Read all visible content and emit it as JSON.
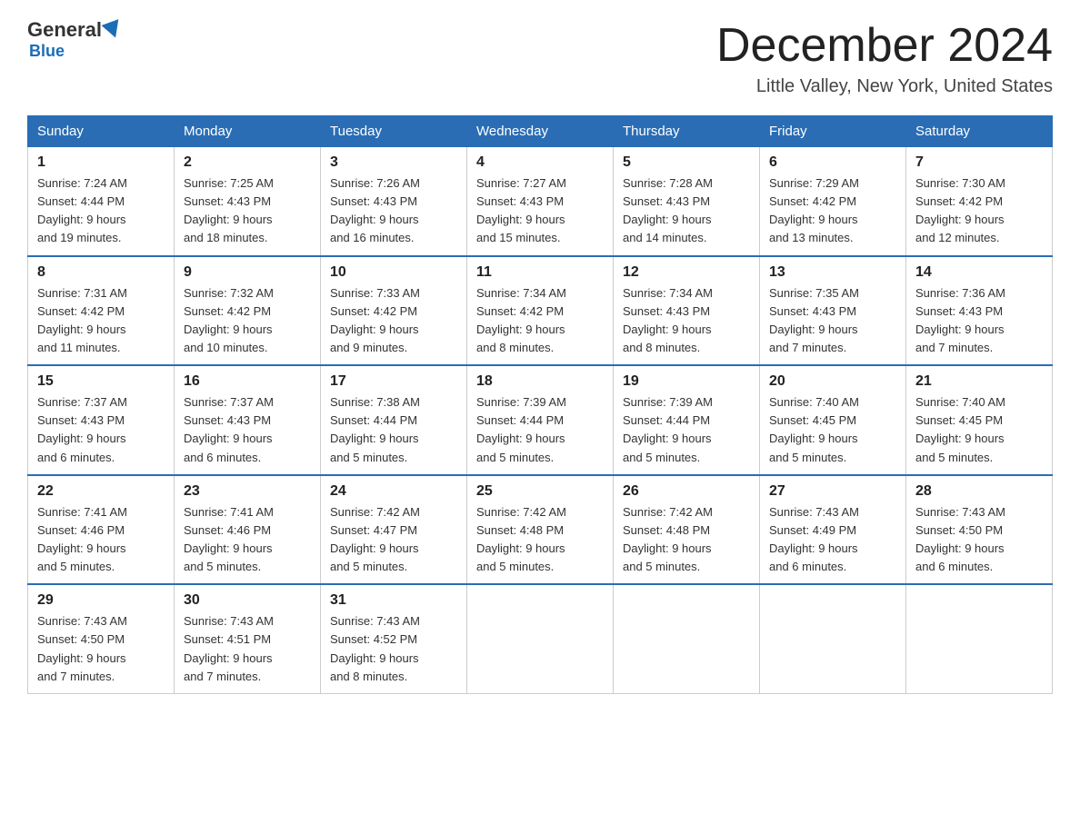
{
  "header": {
    "logo_general": "General",
    "logo_blue": "Blue",
    "month_title": "December 2024",
    "location": "Little Valley, New York, United States"
  },
  "weekdays": [
    "Sunday",
    "Monday",
    "Tuesday",
    "Wednesday",
    "Thursday",
    "Friday",
    "Saturday"
  ],
  "weeks": [
    [
      {
        "day": "1",
        "sunrise": "7:24 AM",
        "sunset": "4:44 PM",
        "daylight": "9 hours and 19 minutes."
      },
      {
        "day": "2",
        "sunrise": "7:25 AM",
        "sunset": "4:43 PM",
        "daylight": "9 hours and 18 minutes."
      },
      {
        "day": "3",
        "sunrise": "7:26 AM",
        "sunset": "4:43 PM",
        "daylight": "9 hours and 16 minutes."
      },
      {
        "day": "4",
        "sunrise": "7:27 AM",
        "sunset": "4:43 PM",
        "daylight": "9 hours and 15 minutes."
      },
      {
        "day": "5",
        "sunrise": "7:28 AM",
        "sunset": "4:43 PM",
        "daylight": "9 hours and 14 minutes."
      },
      {
        "day": "6",
        "sunrise": "7:29 AM",
        "sunset": "4:42 PM",
        "daylight": "9 hours and 13 minutes."
      },
      {
        "day": "7",
        "sunrise": "7:30 AM",
        "sunset": "4:42 PM",
        "daylight": "9 hours and 12 minutes."
      }
    ],
    [
      {
        "day": "8",
        "sunrise": "7:31 AM",
        "sunset": "4:42 PM",
        "daylight": "9 hours and 11 minutes."
      },
      {
        "day": "9",
        "sunrise": "7:32 AM",
        "sunset": "4:42 PM",
        "daylight": "9 hours and 10 minutes."
      },
      {
        "day": "10",
        "sunrise": "7:33 AM",
        "sunset": "4:42 PM",
        "daylight": "9 hours and 9 minutes."
      },
      {
        "day": "11",
        "sunrise": "7:34 AM",
        "sunset": "4:42 PM",
        "daylight": "9 hours and 8 minutes."
      },
      {
        "day": "12",
        "sunrise": "7:34 AM",
        "sunset": "4:43 PM",
        "daylight": "9 hours and 8 minutes."
      },
      {
        "day": "13",
        "sunrise": "7:35 AM",
        "sunset": "4:43 PM",
        "daylight": "9 hours and 7 minutes."
      },
      {
        "day": "14",
        "sunrise": "7:36 AM",
        "sunset": "4:43 PM",
        "daylight": "9 hours and 7 minutes."
      }
    ],
    [
      {
        "day": "15",
        "sunrise": "7:37 AM",
        "sunset": "4:43 PM",
        "daylight": "9 hours and 6 minutes."
      },
      {
        "day": "16",
        "sunrise": "7:37 AM",
        "sunset": "4:43 PM",
        "daylight": "9 hours and 6 minutes."
      },
      {
        "day": "17",
        "sunrise": "7:38 AM",
        "sunset": "4:44 PM",
        "daylight": "9 hours and 5 minutes."
      },
      {
        "day": "18",
        "sunrise": "7:39 AM",
        "sunset": "4:44 PM",
        "daylight": "9 hours and 5 minutes."
      },
      {
        "day": "19",
        "sunrise": "7:39 AM",
        "sunset": "4:44 PM",
        "daylight": "9 hours and 5 minutes."
      },
      {
        "day": "20",
        "sunrise": "7:40 AM",
        "sunset": "4:45 PM",
        "daylight": "9 hours and 5 minutes."
      },
      {
        "day": "21",
        "sunrise": "7:40 AM",
        "sunset": "4:45 PM",
        "daylight": "9 hours and 5 minutes."
      }
    ],
    [
      {
        "day": "22",
        "sunrise": "7:41 AM",
        "sunset": "4:46 PM",
        "daylight": "9 hours and 5 minutes."
      },
      {
        "day": "23",
        "sunrise": "7:41 AM",
        "sunset": "4:46 PM",
        "daylight": "9 hours and 5 minutes."
      },
      {
        "day": "24",
        "sunrise": "7:42 AM",
        "sunset": "4:47 PM",
        "daylight": "9 hours and 5 minutes."
      },
      {
        "day": "25",
        "sunrise": "7:42 AM",
        "sunset": "4:48 PM",
        "daylight": "9 hours and 5 minutes."
      },
      {
        "day": "26",
        "sunrise": "7:42 AM",
        "sunset": "4:48 PM",
        "daylight": "9 hours and 5 minutes."
      },
      {
        "day": "27",
        "sunrise": "7:43 AM",
        "sunset": "4:49 PM",
        "daylight": "9 hours and 6 minutes."
      },
      {
        "day": "28",
        "sunrise": "7:43 AM",
        "sunset": "4:50 PM",
        "daylight": "9 hours and 6 minutes."
      }
    ],
    [
      {
        "day": "29",
        "sunrise": "7:43 AM",
        "sunset": "4:50 PM",
        "daylight": "9 hours and 7 minutes."
      },
      {
        "day": "30",
        "sunrise": "7:43 AM",
        "sunset": "4:51 PM",
        "daylight": "9 hours and 7 minutes."
      },
      {
        "day": "31",
        "sunrise": "7:43 AM",
        "sunset": "4:52 PM",
        "daylight": "9 hours and 8 minutes."
      },
      null,
      null,
      null,
      null
    ]
  ],
  "labels": {
    "sunrise": "Sunrise:",
    "sunset": "Sunset:",
    "daylight": "Daylight:"
  }
}
